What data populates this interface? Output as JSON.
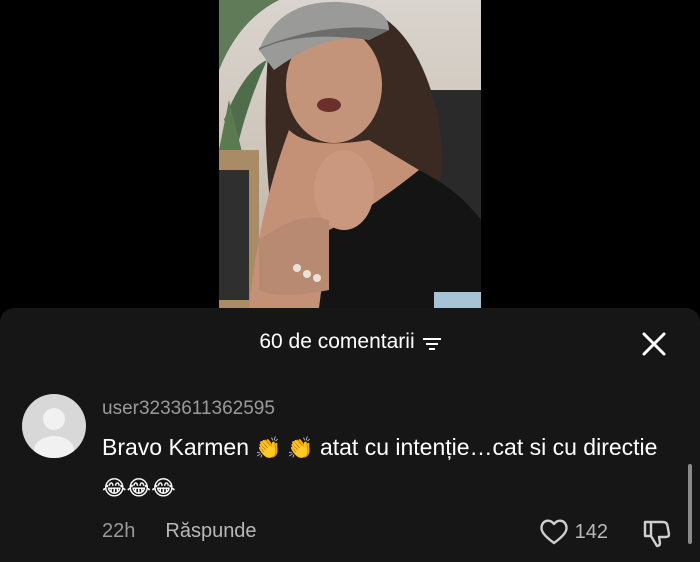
{
  "comments_sheet": {
    "title": "60 de comentarii",
    "filter_icon": "filter-lines-icon",
    "close_icon": "close-icon"
  },
  "comment": {
    "username": "user3233611362595",
    "text_part1": "Bravo Karmen",
    "clap_emojis": "👏 👏",
    "text_part2": " atat cu intenție…cat si cu directie",
    "laugh_emojis": "😂😂😂",
    "time": "22h",
    "reply_label": "Răspunde",
    "like_count": "142"
  }
}
